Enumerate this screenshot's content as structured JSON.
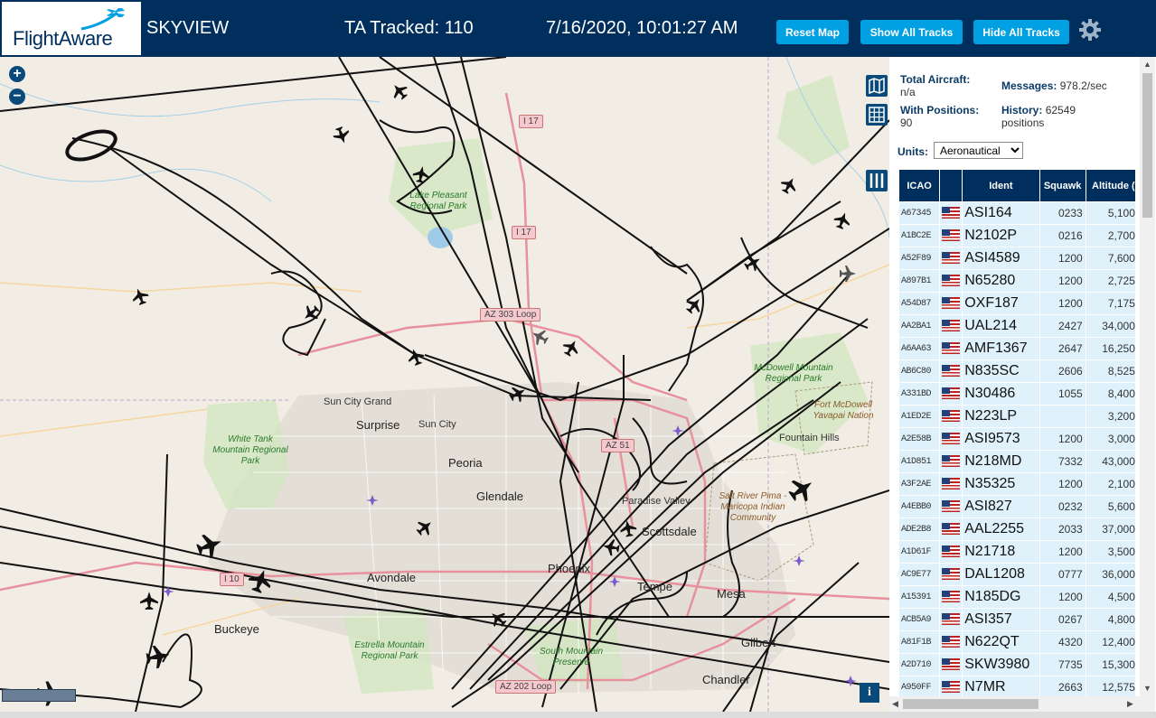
{
  "header": {
    "logo": "FlightAware",
    "app_title": "SKYVIEW",
    "tracked_label": "TA Tracked: 110",
    "datetime": "7/16/2020, 10:01:27 AM",
    "buttons": {
      "reset": "Reset Map",
      "show_all": "Show All Tracks",
      "hide_all": "Hide All Tracks"
    },
    "settings_icon": "gear-icon"
  },
  "map": {
    "zoom_in": "+",
    "zoom_out": "−",
    "info": "i",
    "labels": {
      "sun_city_grand": "Sun City Grand",
      "surprise": "Surprise",
      "sun_city": "Sun City",
      "peoria": "Peoria",
      "glendale": "Glendale",
      "paradise_valley": "Paradise Valley",
      "scottsdale": "Scottsdale",
      "phoenix": "Phoenix",
      "tempe": "Tempe",
      "mesa": "Mesa",
      "gilbert": "Gilbert",
      "chandler": "Chandler",
      "avondale": "Avondale",
      "buckeye": "Buckeye",
      "fountain_hills": "Fountain Hills",
      "white_tank": "White Tank Mountain Regional Park",
      "lake_pleasant": "Lake Pleasant Regional Park",
      "mcdowell": "McDowell Mountain Regional Park",
      "estrella": "Estrella Mountain Regional Park",
      "south_mountain": "South Mountain Preserve",
      "fort_mcdowell": "Fort McDowell Yavapai Nation",
      "salt_river": "Salt River Pima - Maricopa Indian Community"
    },
    "shields": {
      "i17_north": "I 17",
      "i17_mid": "I 17",
      "az303": "AZ 303 Loop",
      "az51": "AZ 51",
      "i10": "I 10",
      "az202": "AZ 202 Loop"
    }
  },
  "stats": {
    "total_label": "Total Aircraft:",
    "total_value": "n/a",
    "positions_label": "With Positions:",
    "positions_value": "90",
    "messages_label": "Messages:",
    "messages_value": "978.2/sec",
    "history_label": "History:",
    "history_value": "62549 positions"
  },
  "units": {
    "label": "Units:",
    "selected": "Aeronautical"
  },
  "table": {
    "headers": {
      "icao": "ICAO",
      "ident": "Ident",
      "squawk": "Squawk",
      "altitude": "Altitude (ft)"
    },
    "rows": [
      {
        "icao": "A67345",
        "ident": "ASI164",
        "squawk": "0233",
        "altitude": "5,100",
        "trend": "▲"
      },
      {
        "icao": "A1BC2E",
        "ident": "N2102P",
        "squawk": "0216",
        "altitude": "2,700",
        "trend": ""
      },
      {
        "icao": "A52F89",
        "ident": "ASI4589",
        "squawk": "1200",
        "altitude": "7,600",
        "trend": "▼"
      },
      {
        "icao": "A897B1",
        "ident": "N65280",
        "squawk": "1200",
        "altitude": "2,725",
        "trend": ""
      },
      {
        "icao": "A54D87",
        "ident": "OXF187",
        "squawk": "1200",
        "altitude": "7,175",
        "trend": ""
      },
      {
        "icao": "AA2BA1",
        "ident": "UAL214",
        "squawk": "2427",
        "altitude": "34,000",
        "trend": ""
      },
      {
        "icao": "A6AA63",
        "ident": "AMF1367",
        "squawk": "2647",
        "altitude": "16,250",
        "trend": "▲"
      },
      {
        "icao": "AB6C80",
        "ident": "N835SC",
        "squawk": "2606",
        "altitude": "8,525",
        "trend": ""
      },
      {
        "icao": "A331BD",
        "ident": "N30486",
        "squawk": "1055",
        "altitude": "8,400",
        "trend": "▼"
      },
      {
        "icao": "A1ED2E",
        "ident": "N223LP",
        "squawk": "",
        "altitude": "3,200",
        "trend": "▲"
      },
      {
        "icao": "A2E58B",
        "ident": "ASI9573",
        "squawk": "1200",
        "altitude": "3,000",
        "trend": "▼"
      },
      {
        "icao": "A1D851",
        "ident": "N218MD",
        "squawk": "7332",
        "altitude": "43,000",
        "trend": ""
      },
      {
        "icao": "A3F2AE",
        "ident": "N35325",
        "squawk": "1200",
        "altitude": "2,100",
        "trend": "▼"
      },
      {
        "icao": "A4EBB0",
        "ident": "ASI827",
        "squawk": "0232",
        "altitude": "5,600",
        "trend": ""
      },
      {
        "icao": "ADE2B8",
        "ident": "AAL2255",
        "squawk": "2033",
        "altitude": "37,000",
        "trend": ""
      },
      {
        "icao": "A1D61F",
        "ident": "N21718",
        "squawk": "1200",
        "altitude": "3,500",
        "trend": "▲"
      },
      {
        "icao": "AC9E77",
        "ident": "DAL1208",
        "squawk": "0777",
        "altitude": "36,000",
        "trend": ""
      },
      {
        "icao": "A15391",
        "ident": "N185DG",
        "squawk": "1200",
        "altitude": "4,500",
        "trend": ""
      },
      {
        "icao": "ACB5A9",
        "ident": "ASI357",
        "squawk": "0267",
        "altitude": "4,800",
        "trend": "▲"
      },
      {
        "icao": "A81F1B",
        "ident": "N622QT",
        "squawk": "4320",
        "altitude": "12,400",
        "trend": ""
      },
      {
        "icao": "A2D710",
        "ident": "SKW3980",
        "squawk": "7735",
        "altitude": "15,300",
        "trend": "▼"
      },
      {
        "icao": "A950FF",
        "ident": "N7MR",
        "squawk": "2663",
        "altitude": "12,575",
        "trend": "▲"
      }
    ]
  },
  "colors": {
    "header_bg": "#002f5d",
    "button_bg": "#00a0e2",
    "row_bg": "#dff1fb"
  }
}
